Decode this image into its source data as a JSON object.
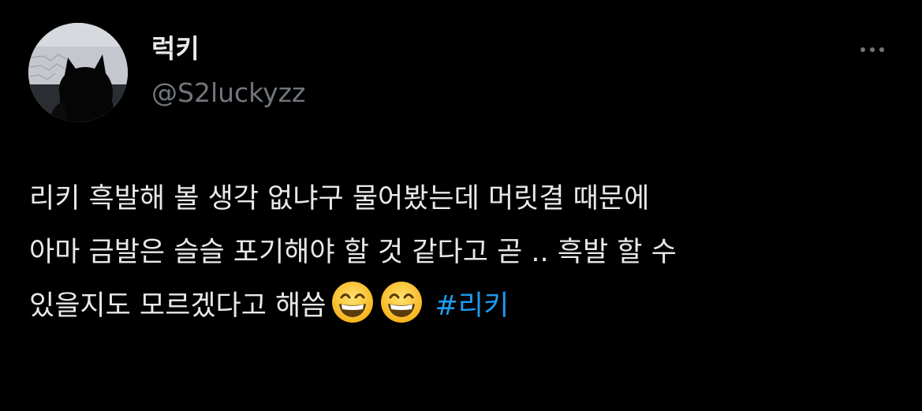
{
  "author": {
    "display_name": "럭키",
    "handle": "@S2luckyzz",
    "avatar_icon": "cat-silhouette-avatar"
  },
  "more_icon": "more-options-icon",
  "tweet": {
    "line1": "리키 흑발해 볼 생각 없냐구 물어봤는데 머릿결 때문에",
    "line2": "아마 금발은 슬슬 포기해야 할 것 같다고 곧 .. 흑발 할 수",
    "line3": "있을지도 모르겠다고 해씀",
    "emoji": [
      "grinning-face-with-smiling-eyes",
      "grinning-face-with-smiling-eyes"
    ],
    "hashtag": "#리키"
  },
  "colors": {
    "background": "#000000",
    "text": "#e7e9ea",
    "secondary": "#71767b",
    "link": "#1d9bf0"
  }
}
